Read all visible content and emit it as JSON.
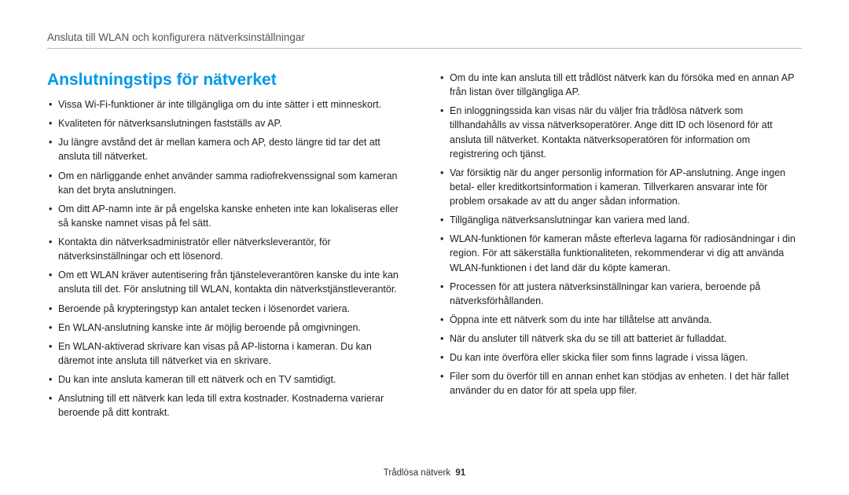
{
  "breadcrumb": "Ansluta till WLAN och konfigurera nätverksinställningar",
  "heading": "Anslutningstips för nätverket",
  "left": [
    "Vissa Wi-Fi-funktioner är inte tillgängliga om du inte sätter i ett minneskort.",
    "Kvaliteten för nätverksanslutningen fastställs av AP.",
    "Ju längre avstånd det är mellan kamera och AP, desto längre tid tar det att ansluta till nätverket.",
    "Om en närliggande enhet använder samma radiofrekvenssignal som kameran kan det bryta anslutningen.",
    "Om ditt AP-namn inte är på engelska kanske enheten inte kan lokaliseras eller så kanske namnet visas på fel sätt.",
    "Kontakta din nätverksadministratör eller nätverksleverantör, för nätverksinställningar och ett lösenord.",
    "Om ett WLAN kräver autentisering från tjänsteleverantören kanske du inte kan ansluta till det. För anslutning till WLAN, kontakta din nätverkstjänstleverantör.",
    "Beroende på krypteringstyp kan antalet tecken i lösenordet variera.",
    "En WLAN-anslutning kanske inte är möjlig beroende på omgivningen.",
    "En WLAN-aktiverad skrivare kan visas på AP-listorna i kameran. Du kan däremot inte ansluta till nätverket via en skrivare.",
    "Du kan inte ansluta kameran till ett nätverk och en TV samtidigt.",
    "Anslutning till ett nätverk kan leda till extra kostnader. Kostnaderna varierar beroende på ditt kontrakt."
  ],
  "right": [
    "Om du inte kan ansluta till ett trådlöst nätverk kan du försöka med en annan AP från listan över tillgängliga AP.",
    "En inloggningssida kan visas när du väljer fria trådlösa nätverk som tillhandahålls av vissa nätverksoperatörer. Ange ditt ID och lösenord för att ansluta till nätverket. Kontakta nätverksoperatören för information om registrering och tjänst.",
    "Var försiktig när du anger personlig information för AP-anslutning. Ange ingen betal- eller kreditkortsinformation i kameran. Tillverkaren ansvarar inte för problem orsakade av att du anger sådan information.",
    "Tillgängliga nätverksanslutningar kan variera med land.",
    "WLAN-funktionen för kameran måste efterleva lagarna för radiosändningar i din region. För att säkerställa funktionaliteten, rekommenderar vi dig att använda WLAN-funktionen i det land där du köpte kameran.",
    "Processen för att justera nätverksinställningar kan variera, beroende på nätverksförhållanden.",
    "Öppna inte ett nätverk som du inte har tillåtelse att använda.",
    "När du ansluter till nätverk ska du se till att batteriet är fulladdat.",
    "Du kan inte överföra eller skicka filer som finns lagrade i vissa lägen.",
    "Filer som du överför till en annan enhet kan stödjas av enheten. I det här fallet använder du en dator för att spela upp filer."
  ],
  "footer_label": "Trådlösa nätverk",
  "page_number": "91"
}
